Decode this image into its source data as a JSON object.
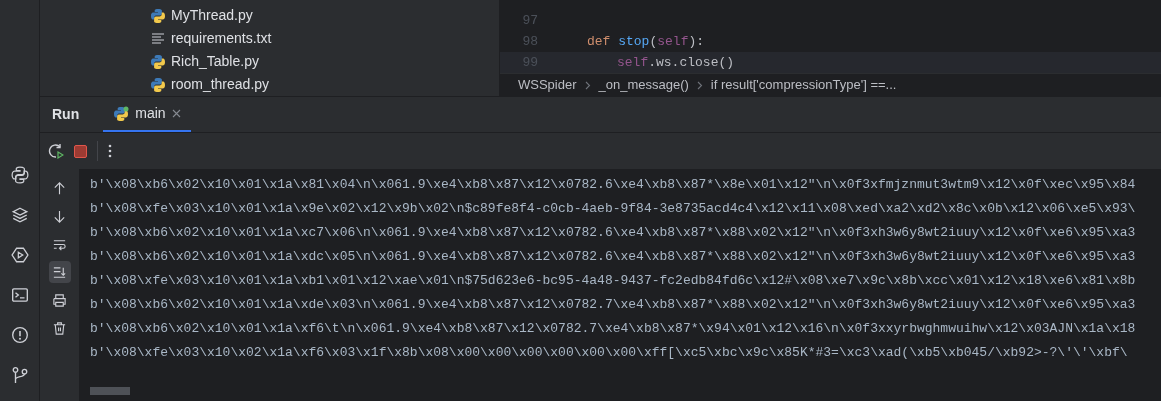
{
  "project_tree": {
    "items": [
      {
        "name": "MyThread.py",
        "kind": "python"
      },
      {
        "name": "requirements.txt",
        "kind": "text"
      },
      {
        "name": "Rich_Table.py",
        "kind": "python"
      },
      {
        "name": "room_thread.py",
        "kind": "python"
      }
    ]
  },
  "editor": {
    "lines": [
      {
        "number": "97",
        "current": false
      },
      {
        "number": "98",
        "current": false,
        "tokens": [
          {
            "kind": "keyword",
            "text": "def "
          },
          {
            "kind": "function",
            "text": "stop"
          },
          {
            "kind": "plain",
            "text": "("
          },
          {
            "kind": "self",
            "text": "self"
          },
          {
            "kind": "plain",
            "text": "):"
          }
        ],
        "children": [
          {
            "number": "99",
            "current": true,
            "tokens": [
              {
                "kind": "self",
                "text": "self"
              },
              {
                "kind": "plain",
                "text": ".ws.close()"
              }
            ]
          }
        ]
      }
    ],
    "breadcrumbs": [
      "WSSpider",
      "_on_message()",
      "if result['compressionType'] ==..."
    ]
  },
  "run_panel": {
    "title": "Run",
    "tabs": [
      {
        "label": "main",
        "selected": true
      }
    ],
    "side_tools": [
      {
        "kind": "up",
        "active": false
      },
      {
        "kind": "down",
        "active": false
      },
      {
        "kind": "wrap",
        "active": false
      },
      {
        "kind": "scroll-end",
        "active": true
      },
      {
        "kind": "print",
        "active": false
      },
      {
        "kind": "trash",
        "active": false
      }
    ],
    "output": [
      "b'\\x08\\xb6\\x02\\x10\\x01\\x1a\\x81\\x04\\n\\x061.9\\xe4\\xb8\\x87\\x12\\x0782.6\\xe4\\xb8\\x87*\\x8e\\x01\\x12\"\\n\\x0f3xfmjznmut3wtm9\\x12\\x0f\\xec\\x95\\x84",
      "b'\\x08\\xfe\\x03\\x10\\x01\\x1a\\x9e\\x02\\x12\\x9b\\x02\\n$c89fe8f4-c0cb-4aeb-9f84-3e8735acd4c4\\x12\\x11\\x08\\xed\\xa2\\xd2\\x8c\\x0b\\x12\\x06\\xe5\\x93\\",
      "b'\\x08\\xb6\\x02\\x10\\x01\\x1a\\xc7\\x06\\n\\x061.9\\xe4\\xb8\\x87\\x12\\x0782.6\\xe4\\xb8\\x87*\\x88\\x02\\x12\"\\n\\x0f3xh3w6y8wt2iuuy\\x12\\x0f\\xe6\\x95\\xa3",
      "b'\\x08\\xb6\\x02\\x10\\x01\\x1a\\xdc\\x05\\n\\x061.9\\xe4\\xb8\\x87\\x12\\x0782.6\\xe4\\xb8\\x87*\\x88\\x02\\x12\"\\n\\x0f3xh3w6y8wt2iuuy\\x12\\x0f\\xe6\\x95\\xa3",
      "b'\\x08\\xfe\\x03\\x10\\x01\\x1a\\xb1\\x01\\x12\\xae\\x01\\n$75d623e6-bc95-4a48-9437-fc2edb84fd6c\\x12#\\x08\\xe7\\x9c\\x8b\\xcc\\x01\\x12\\x18\\xe6\\x81\\x8b",
      "b'\\x08\\xb6\\x02\\x10\\x01\\x1a\\xde\\x03\\n\\x061.9\\xe4\\xb8\\x87\\x12\\x0782.7\\xe4\\xb8\\x87*\\x88\\x02\\x12\"\\n\\x0f3xh3w6y8wt2iuuy\\x12\\x0f\\xe6\\x95\\xa3",
      "b'\\x08\\xb6\\x02\\x10\\x01\\x1a\\xf6\\t\\n\\x061.9\\xe4\\xb8\\x87\\x12\\x0782.7\\xe4\\xb8\\x87*\\x94\\x01\\x12\\x16\\n\\x0f3xxyrbwghmwuihw\\x12\\x03AJN\\x1a\\x18",
      "b'\\x08\\xfe\\x03\\x10\\x02\\x1a\\xf6\\x03\\x1f\\x8b\\x08\\x00\\x00\\x00\\x00\\x00\\x00\\xff[\\xc5\\xbc\\x9c\\x85K*#3=\\xc3\\xad(\\xb5\\xb045/\\xb92>-?\\'\\'\\xbf\\"
    ]
  }
}
